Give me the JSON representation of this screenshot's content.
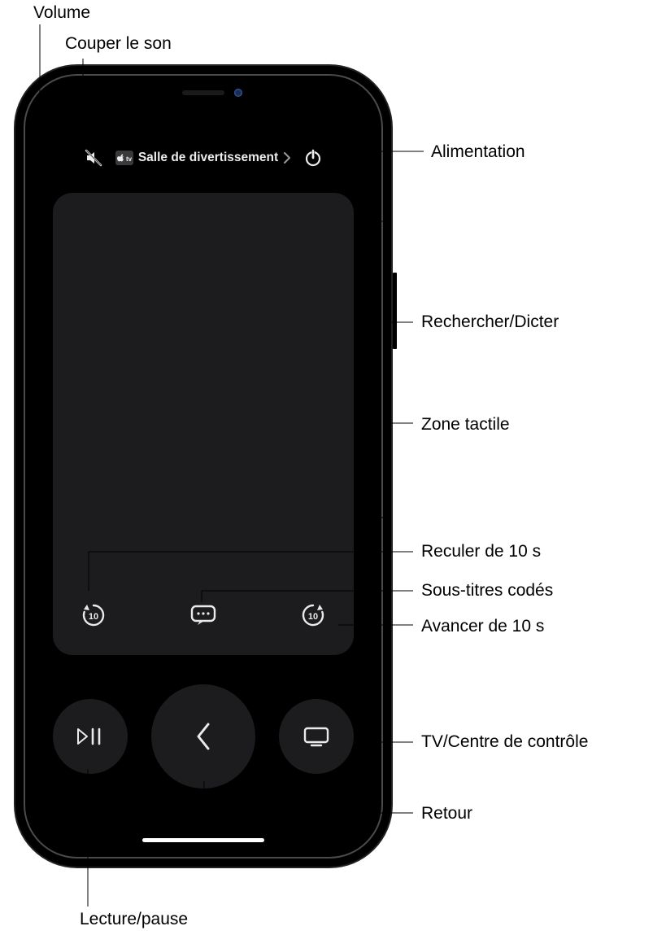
{
  "device_chip": {
    "badge_text": "tv",
    "room_label": "Salle de divertissement"
  },
  "callouts": {
    "volume": "Volume",
    "mute": "Couper le son",
    "power": "Alimentation",
    "search_dictate": "Rechercher/Dicter",
    "touch_area": "Zone tactile",
    "back_10": "Reculer de 10 s",
    "captions": "Sous-titres codés",
    "forward_10": "Avancer de 10 s",
    "tv_cc": "TV/Centre de contrôle",
    "back": "Retour",
    "play_pause": "Lecture/pause"
  },
  "icons": {
    "skip_value": "10"
  }
}
